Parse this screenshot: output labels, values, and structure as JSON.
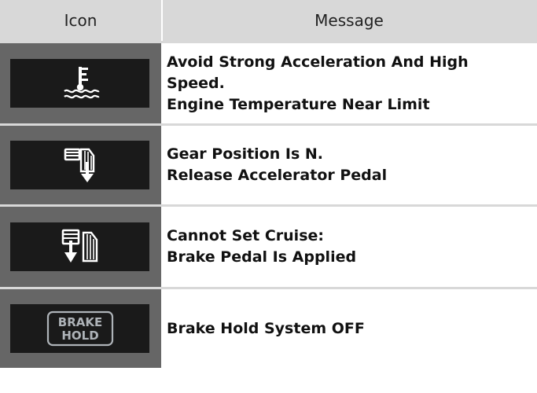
{
  "header": {
    "icon_label": "Icon",
    "message_label": "Message"
  },
  "rows": [
    {
      "icon_name": "engine-temperature-icon",
      "message_lines": [
        "Avoid Strong Acceleration And High",
        "Speed.",
        "Engine Temperature Near Limit"
      ]
    },
    {
      "icon_name": "gear-position-release-accelerator-icon",
      "message_lines": [
        "Gear Position Is N.",
        "Release Accelerator Pedal"
      ]
    },
    {
      "icon_name": "cruise-brake-pedal-icon",
      "message_lines": [
        "Cannot Set Cruise:",
        "Brake Pedal Is Applied"
      ]
    },
    {
      "icon_name": "brake-hold-icon",
      "icon_text_lines": [
        "BRAKE",
        "HOLD"
      ],
      "message_lines": [
        "Brake Hold System OFF"
      ]
    }
  ],
  "colors": {
    "header_bg": "#d8d8d8",
    "icon_panel_bg": "#666666",
    "icon_screen_bg": "#1a1a1a",
    "icon_fg": "#ffffff",
    "brake_hold_fg": "#aeb3b8"
  }
}
